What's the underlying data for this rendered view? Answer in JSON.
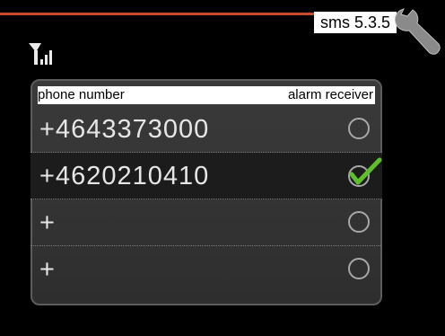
{
  "header": {
    "menu_code": "sms 5.3.5",
    "icons": [
      "signal-strength-icon",
      "wrench-icon"
    ],
    "accent_color": "#c9492c"
  },
  "table": {
    "col_phone": "phone number",
    "col_alarm": "alarm receiver",
    "rows": [
      {
        "number": "+4643373000",
        "alarm_receiver": false
      },
      {
        "number": "+4620210410",
        "alarm_receiver": true
      },
      {
        "number": "+",
        "alarm_receiver": false
      },
      {
        "number": "+",
        "alarm_receiver": false
      }
    ]
  }
}
